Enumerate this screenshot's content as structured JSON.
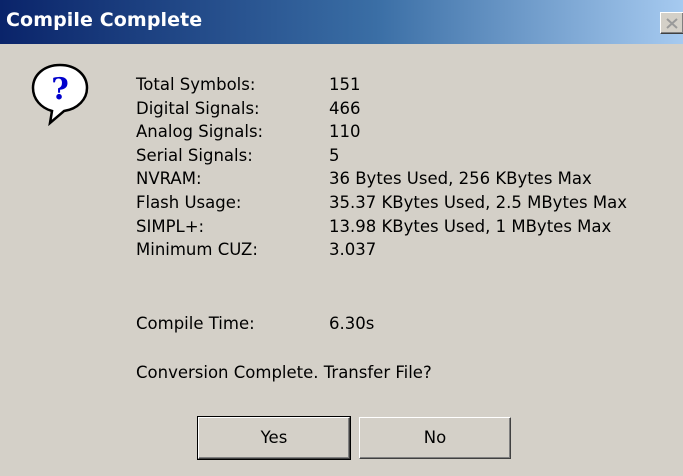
{
  "window": {
    "title": "Compile Complete"
  },
  "icon": {
    "name": "question-icon",
    "glyph": "?"
  },
  "stats": [
    {
      "label": "Total Symbols:",
      "value": "151"
    },
    {
      "label": "Digital Signals:",
      "value": "466"
    },
    {
      "label": "Analog Signals:",
      "value": "110"
    },
    {
      "label": "Serial Signals:",
      "value": "5"
    },
    {
      "label": "NVRAM:",
      "value": "36 Bytes Used, 256 KBytes Max"
    },
    {
      "label": "Flash Usage:",
      "value": "35.37 KBytes Used, 2.5 MBytes Max"
    },
    {
      "label": "SIMPL+:",
      "value": "13.98 KBytes Used, 1 MBytes Max"
    },
    {
      "label": "Minimum CUZ:",
      "value": "3.037"
    }
  ],
  "compile_time": {
    "label": "Compile Time:",
    "value": "6.30s"
  },
  "prompt": "Conversion Complete.  Transfer File?",
  "buttons": {
    "yes": "Yes",
    "no": "No"
  },
  "colors": {
    "title_bar_start": "#0a246a",
    "title_bar_end": "#a6caf0",
    "dialog_bg": "#d4d0c8",
    "icon_glyph": "#0000cc"
  }
}
